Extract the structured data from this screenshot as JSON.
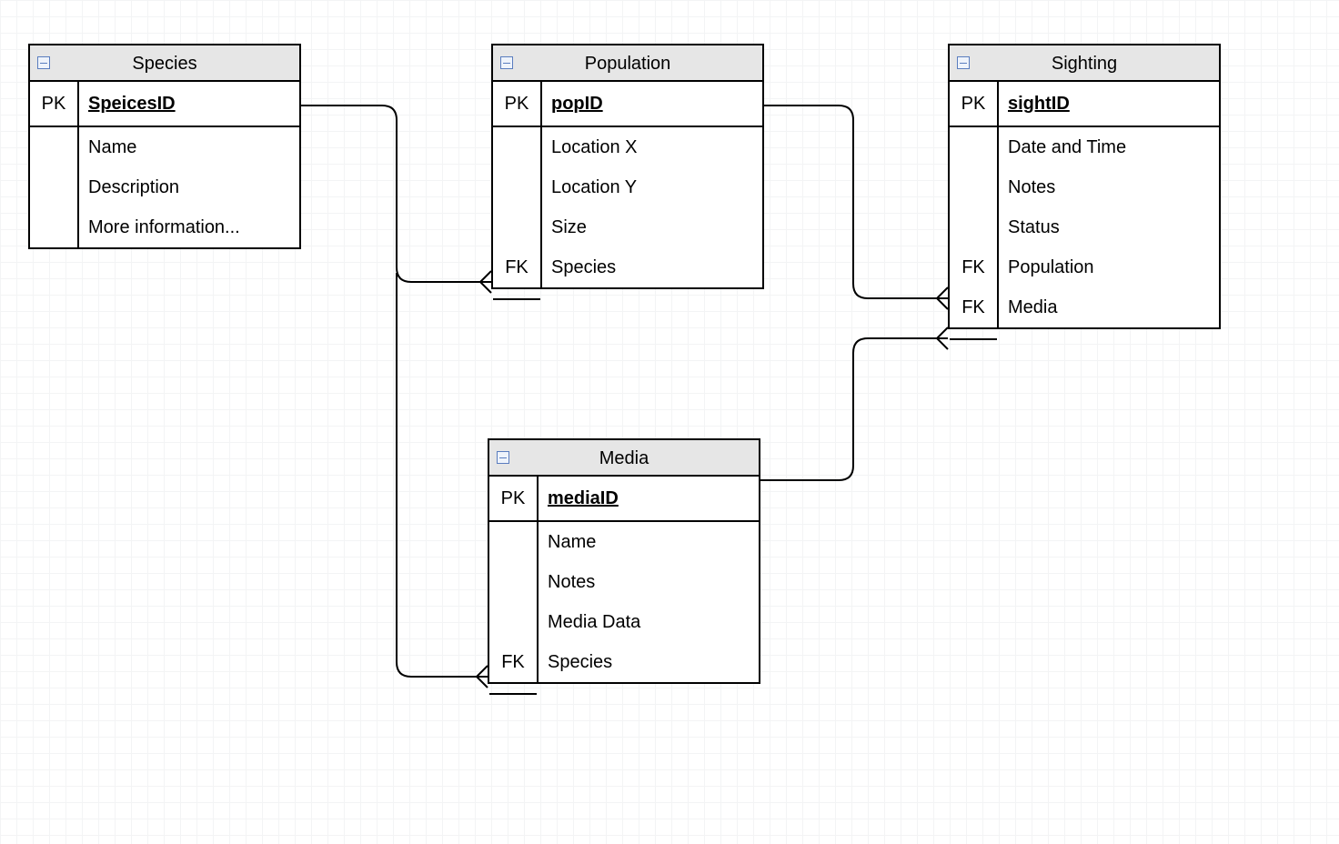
{
  "entities": {
    "species": {
      "title": "Species",
      "pk_label": "PK",
      "pk_field": "SpeicesID",
      "attrs": [
        {
          "key": "",
          "name": "Name"
        },
        {
          "key": "",
          "name": "Description"
        },
        {
          "key": "",
          "name": "More information..."
        }
      ]
    },
    "population": {
      "title": "Population",
      "pk_label": "PK",
      "pk_field": "popID",
      "attrs": [
        {
          "key": "",
          "name": "Location X"
        },
        {
          "key": "",
          "name": "Location Y"
        },
        {
          "key": "",
          "name": "Size"
        },
        {
          "key": "FK",
          "name": "Species"
        }
      ]
    },
    "sighting": {
      "title": "Sighting",
      "pk_label": "PK",
      "pk_field": "sightID",
      "attrs": [
        {
          "key": "",
          "name": "Date and Time"
        },
        {
          "key": "",
          "name": "Notes"
        },
        {
          "key": "",
          "name": "Status"
        },
        {
          "key": "FK",
          "name": "Population"
        },
        {
          "key": "FK",
          "name": "Media"
        }
      ]
    },
    "media": {
      "title": "Media",
      "pk_label": "PK",
      "pk_field": "mediaID",
      "attrs": [
        {
          "key": "",
          "name": "Name"
        },
        {
          "key": "",
          "name": "Notes"
        },
        {
          "key": "",
          "name": "Media Data"
        },
        {
          "key": "FK",
          "name": "Species"
        }
      ]
    }
  },
  "relationships": [
    {
      "from": "Species(SpeicesID)",
      "to": "Population(Species)",
      "type": "one-to-many"
    },
    {
      "from": "Species(SpeicesID)",
      "to": "Media(Species)",
      "type": "one-to-many"
    },
    {
      "from": "Population(popID)",
      "to": "Sighting(Population)",
      "type": "one-to-many"
    },
    {
      "from": "Media(mediaID)",
      "to": "Sighting(Media)",
      "type": "one-to-many"
    }
  ]
}
